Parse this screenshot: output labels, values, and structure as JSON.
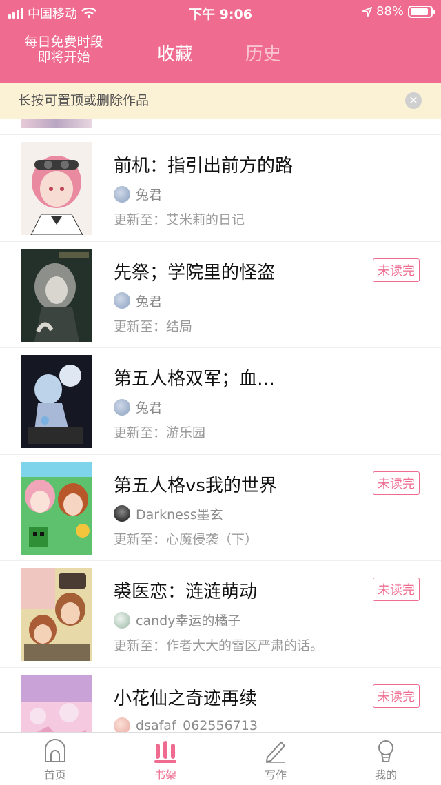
{
  "status_bar": {
    "carrier": "中国移动",
    "time": "下午 9:06",
    "battery": "88%"
  },
  "header": {
    "promo_line1": "每日免费时段",
    "promo_line2": "即将开始",
    "tab_active": "收藏",
    "tab_inactive": "历史"
  },
  "notice": {
    "text": "长按可置顶或删除作品",
    "close_icon": "close-icon"
  },
  "update_prefix": "更新至：",
  "items": [
    {
      "title": "前机：指引出前方的路",
      "author": "兔君",
      "update": "艾米莉的日记",
      "badge": ""
    },
    {
      "title": "先祭；学院里的怪盗",
      "author": "兔君",
      "update": "结局",
      "badge": "未读完"
    },
    {
      "title": "第五人格双军；血…",
      "author": "兔君",
      "update": "游乐园",
      "badge": ""
    },
    {
      "title": "第五人格vs我的世界",
      "author": "Darkness墨玄",
      "update": "心魔侵袭（下）",
      "badge": "未读完"
    },
    {
      "title": "裘医恋：涟涟萌动",
      "author": "candy幸运的橘子",
      "update": "作者大大的雷区严肃的话。",
      "badge": "未读完"
    },
    {
      "title": "小花仙之奇迹再续",
      "author": "dsafaf_062556713",
      "update": "",
      "badge": "未读完"
    }
  ],
  "tabbar": [
    {
      "label": "首页",
      "icon": "home-icon"
    },
    {
      "label": "书架",
      "icon": "bookshelf-icon"
    },
    {
      "label": "写作",
      "icon": "pencil-icon"
    },
    {
      "label": "我的",
      "icon": "profile-icon"
    }
  ],
  "colors": {
    "accent": "#ef6b8f",
    "notice_bg": "#fbf1d4"
  }
}
